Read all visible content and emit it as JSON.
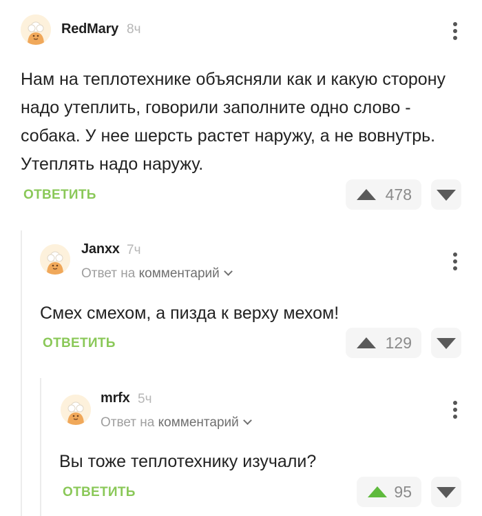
{
  "colors": {
    "accent_green": "#8ac858",
    "upvoted_green": "#5fba3d",
    "muted_text": "#9e9e9e",
    "thread_line": "#ececec"
  },
  "comments": [
    {
      "author": "RedMary",
      "time": "8ч",
      "text": "Нам на теплотехнике объясняли как и какую сторону надо утеплить, говорили заполните одно слово - собака. У нее шерсть растет наружу, а не вовнутрь. Утеплять надо наружу.",
      "reply_label": "ОТВЕТИТЬ",
      "rating": "478",
      "avatar_icon": "chef-avatar-icon"
    },
    {
      "author": "Janxx",
      "time": "7ч",
      "reply_to_prefix": "Ответ на",
      "reply_to_link": "комментарий",
      "text": "Смех смехом, а пизда к верху мехом!",
      "reply_label": "ОТВЕТИТЬ",
      "rating": "129",
      "avatar_icon": "chef-avatar-icon"
    },
    {
      "author": "mrfx",
      "time": "5ч",
      "reply_to_prefix": "Ответ на",
      "reply_to_link": "комментарий",
      "text": "Вы тоже теплотехнику изучали?",
      "reply_label": "ОТВЕТИТЬ",
      "rating": "95",
      "upvoted": true,
      "avatar_icon": "chef-avatar-icon"
    }
  ]
}
